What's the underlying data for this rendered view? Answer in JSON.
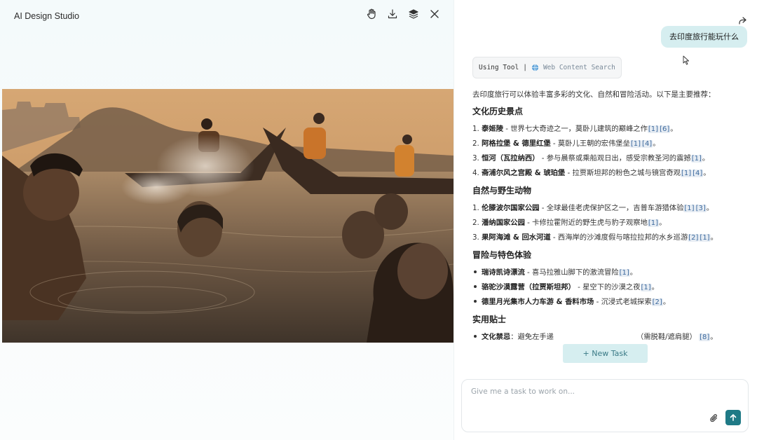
{
  "app": {
    "title": "AI Design Studio"
  },
  "toolbar": {
    "icons": [
      "hand-icon",
      "download-icon",
      "layers-icon",
      "close-icon"
    ]
  },
  "chat": {
    "user_message": "去印度旅行能玩什么",
    "tool_label": "Using Tool",
    "tool_separator": "|",
    "tool_name": "Web Content Search",
    "intro": "去印度旅行可以体验丰富多彩的文化、自然和冒险活动。以下是主要推荐：",
    "sections": [
      {
        "title": "文化历史景点",
        "items": [
          {
            "num": "1.",
            "name": "泰姬陵",
            "desc": " - 世界七大奇迹之一，莫卧儿建筑的巅峰之作",
            "cites": [
              "[1]",
              "[6]"
            ],
            "end": "。"
          },
          {
            "num": "2.",
            "name": "阿格拉堡 & 德里红堡",
            "desc": " - 莫卧儿王朝的宏伟堡垒",
            "cites": [
              "[1]",
              "[4]"
            ],
            "end": "。"
          },
          {
            "num": "3.",
            "name": "恒河（瓦拉纳西）",
            "desc": " - 参与晨祭或乘船观日出，感受宗教圣河的震撼",
            "cites": [
              "[1]"
            ],
            "end": "。"
          },
          {
            "num": "4.",
            "name": "斋浦尔风之宫殿 & 琥珀堡",
            "desc": " - 拉贾斯坦邦的粉色之城与镜宫奇观",
            "cites": [
              "[1]",
              "[4]"
            ],
            "end": "。"
          }
        ]
      },
      {
        "title": "自然与野生动物",
        "items": [
          {
            "num": "1.",
            "name": "伦滕波尔国家公园",
            "desc": " - 全球最佳老虎保护区之一，吉普车游猎体验",
            "cites": [
              "[1]",
              "[3]"
            ],
            "end": "。"
          },
          {
            "num": "2.",
            "name": "潘纳国家公园",
            "desc": " - 卡修拉霍附近的野生虎与豹子观察地",
            "cites": [
              "[1]"
            ],
            "end": "。"
          },
          {
            "num": "3.",
            "name": "果阿海滩 & 回水河道",
            "desc": " - 西海岸的沙滩度假与喀拉拉邦的水乡巡游",
            "cites": [
              "[2]",
              "[1]"
            ],
            "end": "。"
          }
        ]
      },
      {
        "title": "冒险与特色体验",
        "items": [
          {
            "name": "瑞诗凯诗漂流",
            "desc": " - 喜马拉雅山脚下的激流冒险",
            "cites": [
              "[1]"
            ],
            "end": "。"
          },
          {
            "name": "骆驼沙漠露营（拉贾斯坦邦）",
            "desc": " - 星空下的沙漠之夜",
            "cites": [
              "[1]"
            ],
            "end": "。"
          },
          {
            "name": "德里月光集市人力车游 & 香料市场",
            "desc": " - 沉浸式老城探索",
            "cites": [
              "[2]"
            ],
            "end": "。"
          }
        ]
      },
      {
        "title": "实用贴士",
        "items": [
          {
            "name": "文化禁忌",
            "desc": "：避免左手递",
            "tail": "（需脱鞋/遮肩腿）",
            "cites": [
              "[8]"
            ],
            "end": "。"
          }
        ]
      }
    ]
  },
  "new_task_label": "+ New Task",
  "composer": {
    "placeholder": "Give me a task to work on..."
  }
}
